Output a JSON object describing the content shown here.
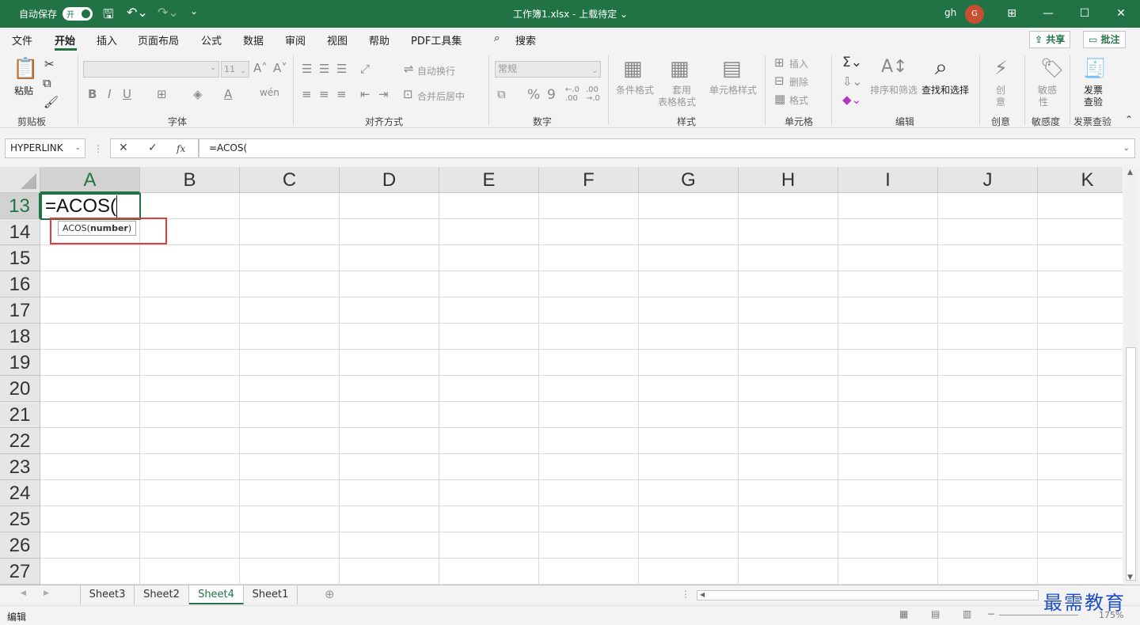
{
  "titlebar": {
    "autosave_label": "自动保存",
    "autosave_state": "开",
    "doc_title": "工作簿1.xlsx  -  上载待定  ⌄",
    "user": "gh",
    "avatar_initial": "G"
  },
  "menu": {
    "tabs": [
      "文件",
      "开始",
      "插入",
      "页面布局",
      "公式",
      "数据",
      "审阅",
      "视图",
      "帮助",
      "PDF工具集"
    ],
    "active": "开始",
    "search_label": "搜索",
    "share_label": "共享",
    "comment_label": "批注"
  },
  "ribbon": {
    "clipboard": {
      "paste": "粘贴",
      "label": "剪贴板"
    },
    "font": {
      "size": "11",
      "label": "字体"
    },
    "alignment": {
      "wrap": "自动换行",
      "merge": "合并后居中",
      "label": "对齐方式"
    },
    "number": {
      "format": "常规",
      "label": "数字"
    },
    "styles": {
      "conditional": "条件格式",
      "table_line1": "套用",
      "table_line2": "表格格式",
      "cell_styles": "单元格样式",
      "label": "样式"
    },
    "cells": {
      "insert": "插入",
      "delete": "删除",
      "format": "格式",
      "label": "单元格"
    },
    "editing": {
      "sort": "排序和筛选",
      "find": "查找和选择",
      "label": "编辑"
    },
    "creative": {
      "line1": "创",
      "line2": "意",
      "label": "创意"
    },
    "sensitivity": {
      "line1": "敏感",
      "line2": "性",
      "label": "敏感度"
    },
    "invoice": {
      "line1": "发票",
      "line2": "查验",
      "label": "发票查验"
    }
  },
  "formula_bar": {
    "name_box": "HYPERLINK",
    "formula": "=ACOS(",
    "fx": "fx"
  },
  "grid": {
    "columns": [
      "A",
      "B",
      "C",
      "D",
      "E",
      "F",
      "G",
      "H",
      "I",
      "J",
      "K"
    ],
    "rows": [
      "13",
      "14",
      "15",
      "16",
      "17",
      "18",
      "19",
      "20",
      "21",
      "22",
      "23",
      "24",
      "25",
      "26",
      "27"
    ],
    "active_cell_text": "=ACOS(",
    "tooltip_fn": "ACOS(",
    "tooltip_arg": "number",
    "tooltip_close": ")"
  },
  "sheets": {
    "tabs": [
      "Sheet3",
      "Sheet2",
      "Sheet4",
      "Sheet1"
    ],
    "active": "Sheet4"
  },
  "status": {
    "mode": "编辑",
    "zoom": "175%"
  },
  "watermark": "最需教育",
  "colors": {
    "accent": "#217346",
    "highlight": "#e03c3c"
  }
}
